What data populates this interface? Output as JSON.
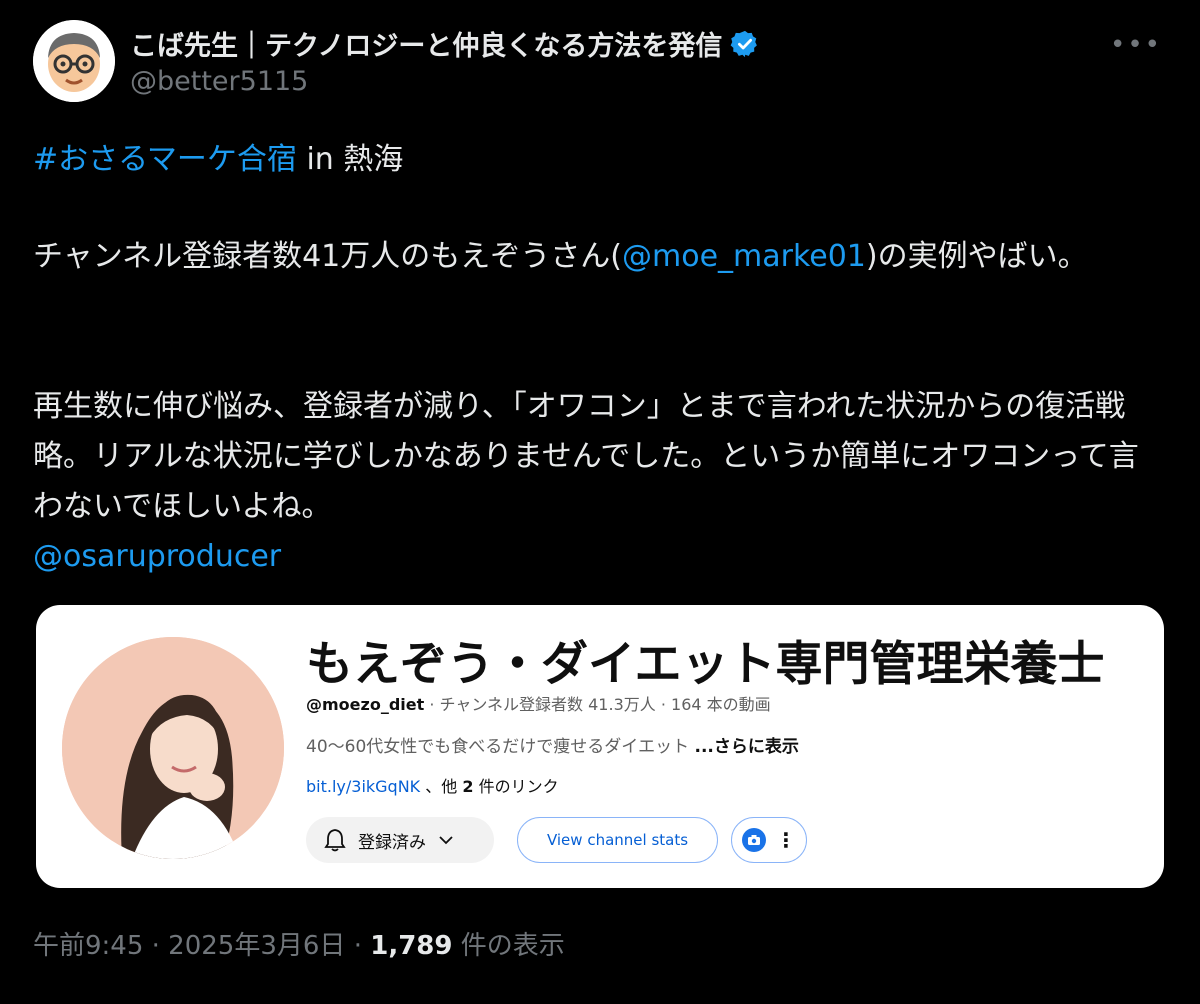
{
  "author": {
    "display_name": "こば先生｜テクノロジーと仲良くなる方法を発信",
    "handle": "@better5115",
    "avatar_icon": "cartoon-man-with-glasses"
  },
  "tweet": {
    "hashtag": "#おさるマーケ合宿",
    "line1_rest": " in 熱海",
    "p2_before": "チャンネル登録者数41万人のもえぞうさん(",
    "p2_mention": "@moe_marke01",
    "p2_after": ")の実例やばい。",
    "p3": "再生数に伸び悩み、登録者が減り、「オワコン」とまで言われた状況からの復活戦略。リアルな状況に学びしかなありませんでした。というか簡単にオワコンって言わないでほしいよね。",
    "p4_mention": "@osaruproducer"
  },
  "card": {
    "channel_title": "もえぞう・ダイエット専門管理栄養士",
    "channel_handle": "@moezo_diet",
    "channel_stats": " · チャンネル登録者数 41.3万人 · 164 本の動画",
    "description": "40～60代女性でも食べるだけで痩せるダイエット ",
    "more_label": "...さらに表示",
    "link_text": "bit.ly/3ikGqNK",
    "link_suffix_1": " 、他 ",
    "link_count": "2",
    "link_suffix_2": " 件のリンク",
    "subscribe_label": "登録済み",
    "stats_button_label": "View channel stats"
  },
  "footer": {
    "time": "午前9:45 · 2025年3月6日 · ",
    "views": "1,789",
    "views_label": " 件の表示"
  },
  "colors": {
    "background": "#000000",
    "link": "#1d9bf0",
    "muted": "#71767b",
    "verified": "#1d9bf0"
  }
}
